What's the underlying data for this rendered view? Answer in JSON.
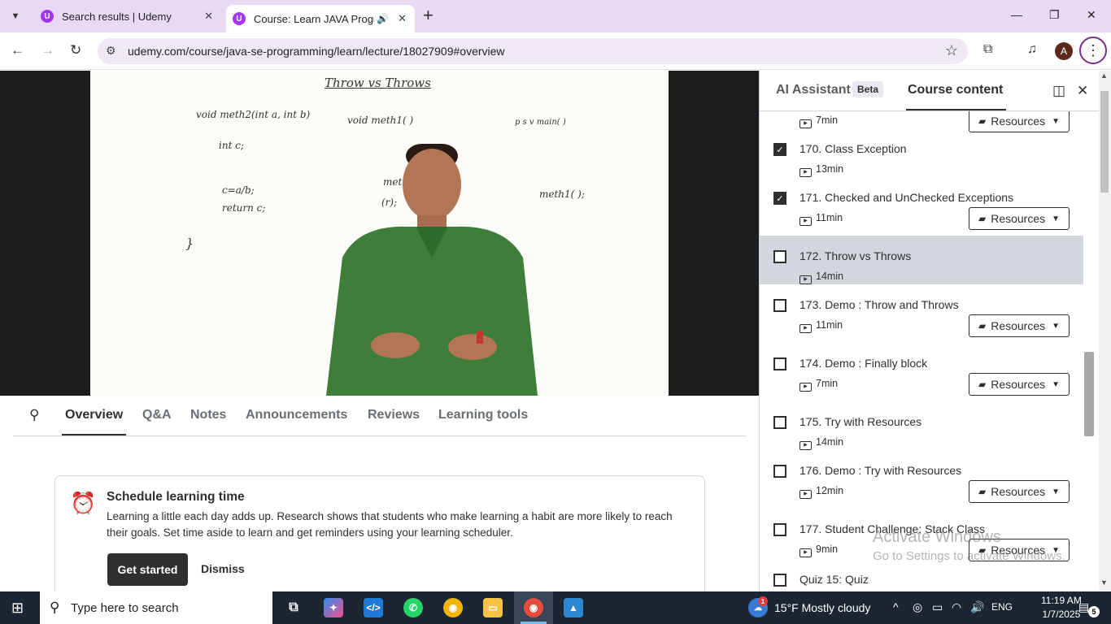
{
  "browser": {
    "tabs": [
      {
        "title": "Search results | Udemy"
      },
      {
        "title": "Course: Learn JAVA Programming"
      }
    ],
    "url": "udemy.com/course/java-se-programming/learn/lecture/18027909#overview",
    "profile_initial": "A"
  },
  "video": {
    "board": {
      "heading": "Throw vs Throws",
      "line1": "void meth2(int a, int b)",
      "line2": "void meth1( )",
      "line3": "p s v main( )",
      "line4": "int c;",
      "line5": "meth2(10,0);",
      "line6": "c=a/b;",
      "line7": "return c;",
      "line8": "meth1( );",
      "line9": "(r);"
    }
  },
  "lesson_tabs": [
    "Overview",
    "Q&A",
    "Notes",
    "Announcements",
    "Reviews",
    "Learning tools"
  ],
  "schedule_card": {
    "title": "Schedule learning time",
    "description": "Learning a little each day adds up. Research shows that students who make learning a habit are more likely to reach their goals. Set time aside to learn and get reminders using your learning scheduler.",
    "primary_label": "Get started",
    "secondary_label": "Dismiss"
  },
  "sidebar": {
    "tab_ai": "AI Assistant",
    "beta": "Beta",
    "tab_content": "Course content",
    "resources_label": "Resources",
    "lectures": [
      {
        "title": "",
        "duration": "7min",
        "checked": true,
        "resources": true
      },
      {
        "title": "170. Class Exception",
        "duration": "13min",
        "checked": true,
        "resources": false
      },
      {
        "title": "171. Checked and UnChecked Exceptions",
        "duration": "11min",
        "checked": true,
        "resources": true
      },
      {
        "title": "172. Throw vs Throws",
        "duration": "14min",
        "checked": false,
        "resources": false,
        "active": true
      },
      {
        "title": "173. Demo : Throw and Throws",
        "duration": "11min",
        "checked": false,
        "resources": true
      },
      {
        "title": "174. Demo : Finally block",
        "duration": "7min",
        "checked": false,
        "resources": true
      },
      {
        "title": "175. Try with Resources",
        "duration": "14min",
        "checked": false,
        "resources": false
      },
      {
        "title": "176. Demo : Try with Resources",
        "duration": "12min",
        "checked": false,
        "resources": true
      },
      {
        "title": "177. Student Challenge: Stack Class",
        "duration": "9min",
        "checked": false,
        "resources": true
      },
      {
        "title": "Quiz 15: Quiz",
        "duration": "",
        "checked": false,
        "resources": false
      }
    ]
  },
  "watermark": {
    "line1": "Activate Windows",
    "line2": "Go to Settings to activate Windows."
  },
  "taskbar": {
    "search_placeholder": "Type here to search",
    "weather": "15°F  Mostly cloudy",
    "language": "ENG",
    "time": "11:19 AM",
    "date": "1/7/2025",
    "notification_count": "5",
    "weather_badge": "1"
  }
}
